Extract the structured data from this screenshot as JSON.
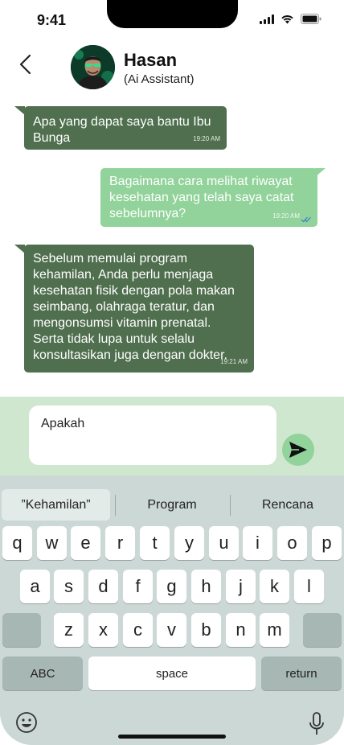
{
  "status": {
    "time": "9:41"
  },
  "header": {
    "name": "Hasan",
    "subtitle": "(Ai Assistant)"
  },
  "messages": [
    {
      "direction": "in",
      "text_lines": [
        "Apa yang dapat saya bantu Ibu",
        "Bunga"
      ],
      "time": "19:20 AM"
    },
    {
      "direction": "out",
      "text_lines": [
        "Bagaimana cara melihat riwayat",
        "kesehatan yang telah saya catat",
        "sebelumnya?"
      ],
      "time": "19:20 AM",
      "read": true
    },
    {
      "direction": "in",
      "text_lines": [
        "Sebelum memulai program",
        "kehamilan, Anda perlu menjaga",
        "kesehatan fisik dengan pola makan",
        "seimbang, olahraga teratur, dan",
        "mengonsumsi vitamin prenatal.",
        "Serta tidak lupa untuk selalu",
        "konsultasikan juga dengan dokter."
      ],
      "time": "19:21 AM"
    }
  ],
  "composer": {
    "value": "Apakah"
  },
  "keyboard": {
    "suggestions": [
      "”Kehamilan”",
      "Program",
      "Rencana"
    ],
    "row1": [
      "q",
      "w",
      "e",
      "r",
      "t",
      "y",
      "u",
      "i",
      "o",
      "p"
    ],
    "row2": [
      "a",
      "s",
      "d",
      "f",
      "g",
      "h",
      "j",
      "k",
      "l"
    ],
    "row3": [
      "z",
      "x",
      "c",
      "v",
      "b",
      "n",
      "m"
    ],
    "abc": "ABC",
    "space": "space",
    "return": "return"
  },
  "colors": {
    "incoming": "#4f6f4e",
    "outgoing": "#91d39a",
    "composer_bg": "#cfe6cf",
    "keyboard_bg": "#ccd8d6"
  }
}
